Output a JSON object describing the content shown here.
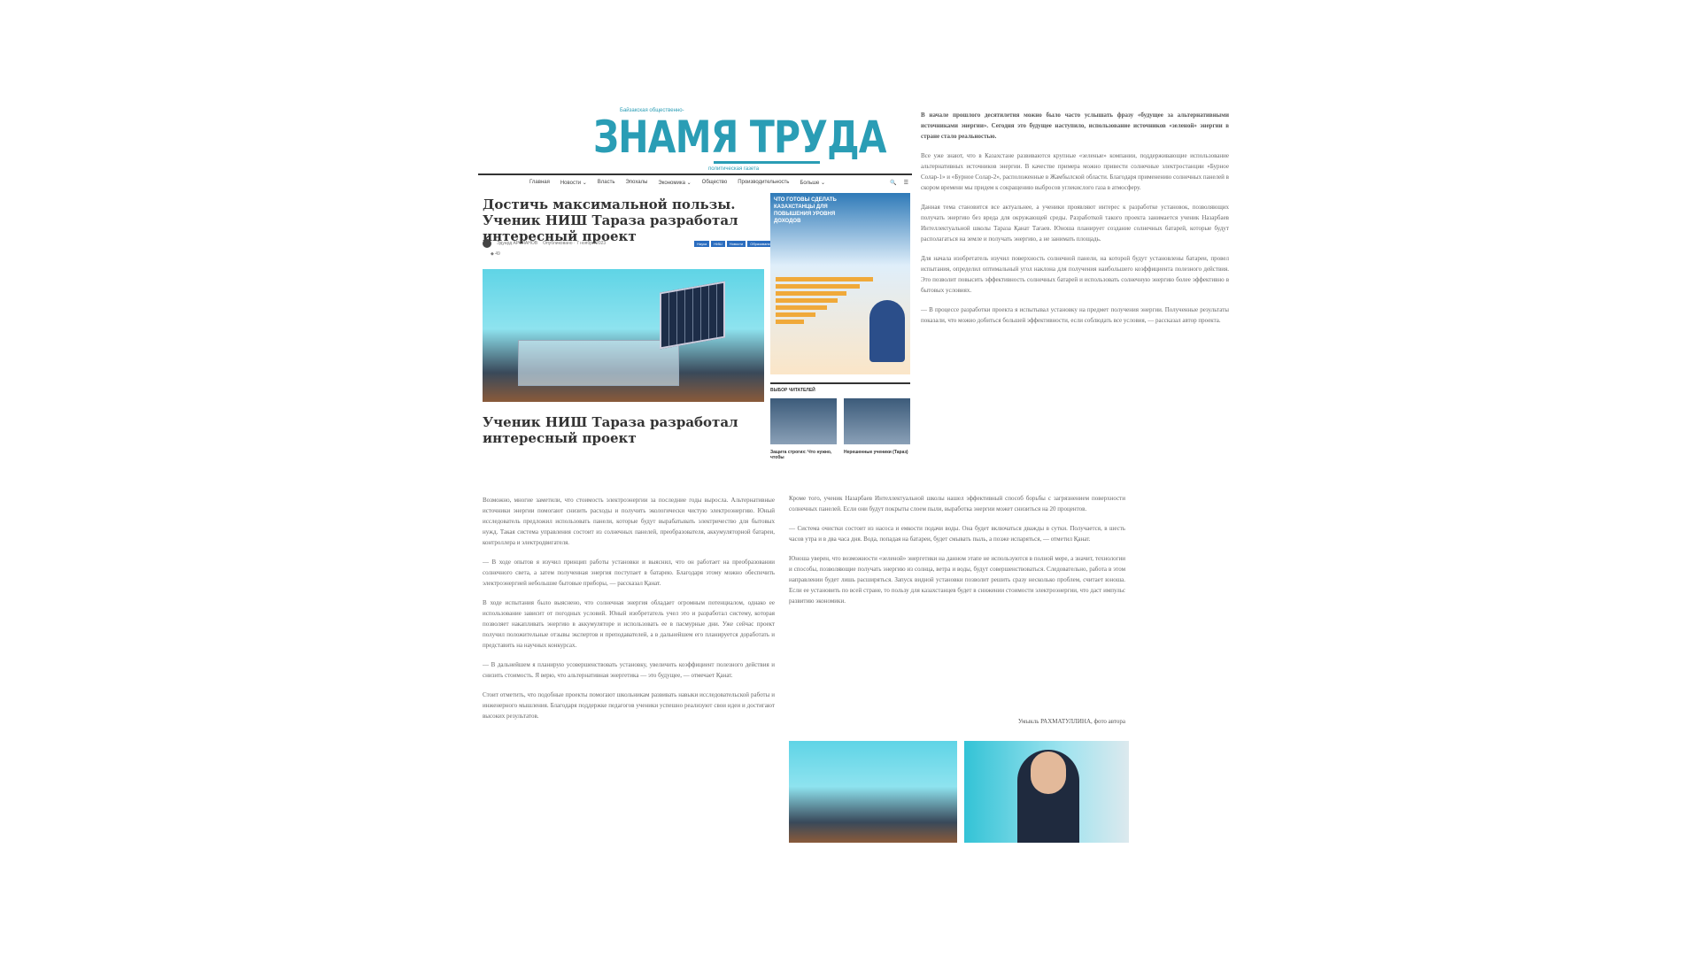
{
  "masthead": {
    "tagline": "Байзакская общественно-",
    "logo": "ЗНАМЯ ТРУДА",
    "subline": "политическая газета"
  },
  "nav": {
    "items": [
      "Главная",
      "Новости ⌄",
      "Власть",
      "Эпохалы",
      "Экономика ⌄",
      "Общество",
      "Производительность",
      "Больше ⌄"
    ],
    "search_icon": "🔍",
    "menu_icon": "☰"
  },
  "article": {
    "title": "Достичь максимальной пользы. Ученик НИШ Тараза разработал интересный проект",
    "author": "Эдуард АРСЛАНОВ",
    "date": "Опубликовано · 7 ноября 2023",
    "tags": [
      "Наука",
      "НИШ",
      "Новости",
      "Образование"
    ],
    "views": "◆ 49",
    "section_title": "Ученик НИШ Тараза разработал интересный проект"
  },
  "sidebar": {
    "promo_title": "ЧТО ГОТОВЫ СДЕЛАТЬ КАЗАХСТАНЦЫ ДЛЯ ПОВЫШЕНИЯ УРОВНЯ ДОХОДОВ",
    "heading": "ВЫБОР ЧИТАТЕЛЕЙ",
    "thumb_captions": [
      "Защита строгих: Что нужно, чтобы",
      "Нерешенные ученики (Тараз)"
    ]
  },
  "text_top_right": [
    "В начале прошлого десятилетия можно было часто услышать фразу «будущее за альтернативными источниками энергии». Сегодня это будущее наступило, использование источников «зеленой» энергии в стране стало реальностью.",
    "Все уже знают, что в Казахстане развиваются крупные «зеленые» компании, поддерживающие использование альтернативных источников энергии. В качестве примера можно привести солнечные электростанции «Бурное Солар-1» и «Бурное Солар-2», расположенные в Жамбылской области. Благодаря применению солнечных панелей в скором времени мы придем к сокращению выбросов углекислого газа в атмосферу.",
    "Данная тема становится все актуальнее, а ученики проявляют интерес к разработке установок, позволяющих получать энергию без вреда для окружающей среды. Разработкой такого проекта занимается ученик Назарбаев Интеллектуальной школы Тараза Қанат Тағаев. Юноша планирует создание солнечных батарей, которые будут располагаться на земле и получать энергию, а не занимать площадь.",
    "Для начала изобретатель изучил поверхность солнечной панели, на которой будут установлены батареи, провел испытания, определил оптимальный угол наклона для получения наибольшего коэффициента полезного действия. Это позволит повысить эффективность солнечных батарей и использовать солнечную энергию более эффективно в бытовых условиях.",
    "— В процессе разработки проекта я испытывал установку на предмет получения энергии. Полученные результаты показали, что можно добиться большей эффективности, если соблюдать все условия, — рассказал автор проекта."
  ],
  "text_bottom_left": [
    "Возможно, многие заметили, что стоимость электроэнергии за последние годы выросла. Альтернативные источники энергии помогают снизить расходы и получить экологически чистую электроэнергию. Юный исследователь предложил использовать панели, которые будут вырабатывать электричество для бытовых нужд. Такая система управления состоит из солнечных панелей, преобразователя, аккумуляторной батареи, контроллера и электродвигателя.",
    "— В ходе опытов я изучил принцип работы установки и выяснил, что он работает на преобразовании солнечного света, а затем полученная энергия поступает в батарею. Благодаря этому можно обеспечить электроэнергией небольшие бытовые приборы, — рассказал Қанат.",
    "В ходе испытания было выяснено, что солнечная энергия обладает огромным потенциалом, однако ее использование зависит от погодных условий. Юный изобретатель учел это и разработал систему, которая позволяет накапливать энергию в аккумуляторе и использовать ее в пасмурные дни. Уже сейчас проект получил положительные отзывы экспертов и преподавателей, а в дальнейшем его планируется доработать и представить на научных конкурсах.",
    "— В дальнейшем я планирую усовершенствовать установку, увеличить коэффициент полезного действия и снизить стоимость. Я верю, что альтернативная энергетика — это будущее, — отмечает Қанат.",
    "Стоит отметить, что подобные проекты помогают школьникам развивать навыки исследовательской работы и инженерного мышления. Благодаря поддержке педагогов ученики успешно реализуют свои идеи и достигают высоких результатов."
  ],
  "text_bottom_right": [
    "Кроме того, ученик Назарбаев Интеллектуальной школы нашел эффективный способ борьбы с загрязнением поверхности солнечных панелей. Если они будут покрыты слоем пыли, выработка энергии может снизиться на 20 процентов.",
    "— Система очистки состоит из насоса и емкости подачи воды. Она будет включаться дважды в сутки. Получается, в шесть часов утра и в два часа дня. Вода, попадая на батареи, будет смывать пыль, а позже испаряться, — отметил Қанат.",
    "Юноша уверен, что возможности «зеленой» энергетики на данном этапе не используются в полной мере, а значит, технологии и способы, позволяющие получать энергию из солнца, ветра и воды, будут совершенствоваться. Следовательно, работа в этом направлении будет лишь расширяться. Запуск видной установки позволит решить сразу несколько проблем, считает юноша. Если ее установить по всей стране, то пользу для казахстанцев будет в снижении стоимости электроэнергии, что даст импульс развитию экономики."
  ],
  "credit": "Умыкль РАХМАТУЛЛИНА, фото автора"
}
